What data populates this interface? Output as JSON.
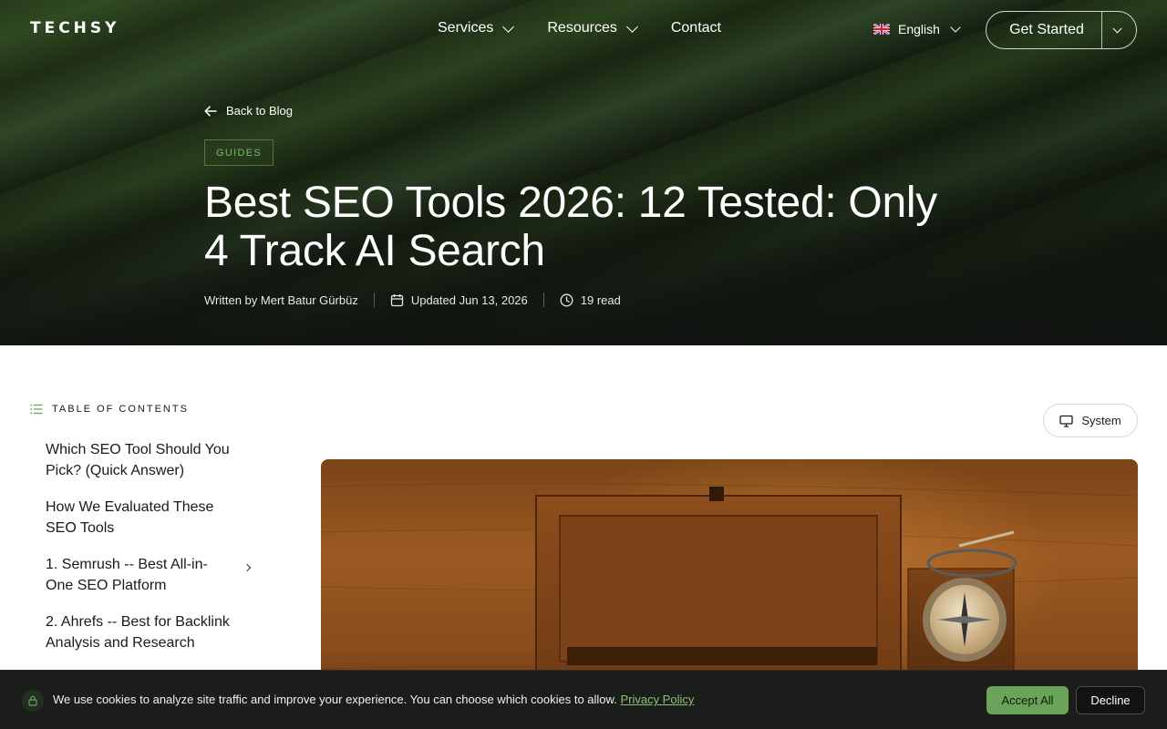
{
  "brand": {
    "logo": "TECHSY"
  },
  "nav": {
    "links": [
      {
        "label": "Services"
      },
      {
        "label": "Resources"
      },
      {
        "label": "Contact"
      }
    ],
    "language": "English",
    "cta": "Get Started"
  },
  "article": {
    "back_label": "Back to Blog",
    "category": "GUIDES",
    "title": "Best SEO Tools 2026: 12 Tested: Only 4 Track AI Search",
    "author": "Written by Mert Batur Gürbüz",
    "updated": "Updated Jun 13, 2026",
    "read_time": "19 read"
  },
  "toc": {
    "heading": "TABLE OF CONTENTS",
    "items": [
      {
        "label": "Which SEO Tool Should You Pick? (Quick Answer)"
      },
      {
        "label": "How We Evaluated These SEO Tools"
      },
      {
        "label": "1. Semrush -- Best All-in-One SEO Platform"
      },
      {
        "label": "2. Ahrefs -- Best for Backlink Analysis and Research"
      }
    ]
  },
  "theme_toggle": {
    "label": "System"
  },
  "cookie": {
    "message": "We use cookies to analyze site traffic and improve your experience. You can choose which cookies to allow.",
    "policy_link": "Privacy Policy",
    "accept": "Accept All",
    "decline": "Decline"
  },
  "colors": {
    "accent_green": "#6aa45b",
    "hero_dark": "#141a11",
    "link_green": "#8ec07a"
  }
}
